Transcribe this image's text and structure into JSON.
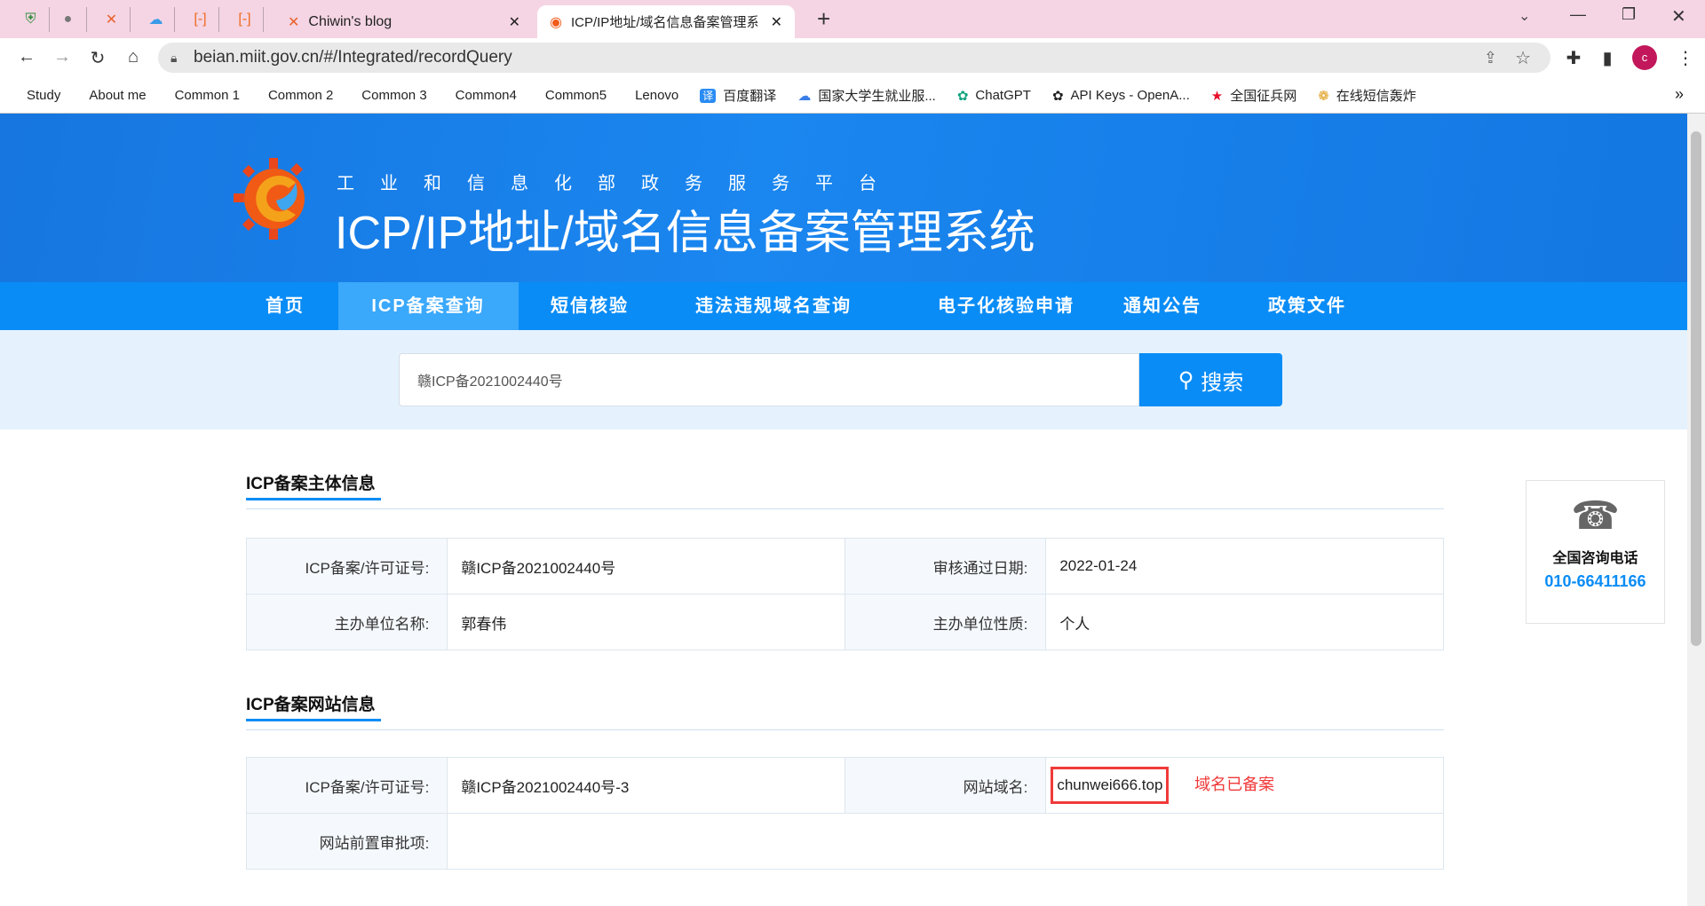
{
  "browser": {
    "tabs": [
      {
        "label": "Chiwin's blog"
      },
      {
        "label": "ICP/IP地址/域名信息备案管理系统",
        "active": true
      }
    ],
    "new_tab": "+",
    "url": "beian.miit.gov.cn/#/Integrated/recordQuery",
    "profile_initial": "c",
    "bookmarks": [
      {
        "label": "Study",
        "icon": "folder-icon"
      },
      {
        "label": "About me",
        "icon": "folder-icon"
      },
      {
        "label": "Common 1",
        "icon": "folder-icon"
      },
      {
        "label": "Common 2",
        "icon": "folder-icon"
      },
      {
        "label": "Common 3",
        "icon": "folder-icon"
      },
      {
        "label": "Common4",
        "icon": "folder-icon"
      },
      {
        "label": "Common5",
        "icon": "folder-icon"
      },
      {
        "label": "Lenovo",
        "icon": "folder-icon"
      },
      {
        "label": "百度翻译",
        "icon": "translate-icon"
      },
      {
        "label": "国家大学生就业服...",
        "icon": "cloud-icon"
      },
      {
        "label": "ChatGPT",
        "icon": "chatgpt-icon"
      },
      {
        "label": "API Keys - OpenA...",
        "icon": "openai-icon"
      },
      {
        "label": "全国征兵网",
        "icon": "star-icon"
      },
      {
        "label": "在线短信轰炸",
        "icon": "color-wheel-icon"
      }
    ],
    "more": "»"
  },
  "header": {
    "subtitle": "工业和信息化部政务服务平台",
    "title": "ICP/IP地址/域名信息备案管理系统"
  },
  "nav": [
    {
      "label": "首页"
    },
    {
      "label": "ICP备案查询",
      "active": true
    },
    {
      "label": "短信核验"
    },
    {
      "label": "违法违规域名查询"
    },
    {
      "label": "电子化核验申请"
    },
    {
      "label": "通知公告"
    },
    {
      "label": "政策文件"
    }
  ],
  "search": {
    "value": "赣ICP备2021002440号",
    "button": "搜索"
  },
  "subject": {
    "title": "ICP备案主体信息",
    "rows": [
      [
        {
          "label": "ICP备案/许可证号:",
          "value": "赣ICP备2021002440号"
        },
        {
          "label": "审核通过日期:",
          "value": "2022-01-24"
        }
      ],
      [
        {
          "label": "主办单位名称:",
          "value": "郭春伟"
        },
        {
          "label": "主办单位性质:",
          "value": "个人"
        }
      ]
    ]
  },
  "website": {
    "title": "ICP备案网站信息",
    "license_label": "ICP备案/许可证号:",
    "license": "赣ICP备2021002440号-3",
    "domain_label": "网站域名:",
    "domain": "chunwei666.top",
    "annotation": "域名已备案",
    "approval_label": "网站前置审批项:",
    "approval": ""
  },
  "hotline": {
    "label": "全国咨询电话",
    "number": "010-66411166"
  },
  "colors": {
    "accent": "#0a8cf6",
    "annotation": "#f03a3a"
  }
}
